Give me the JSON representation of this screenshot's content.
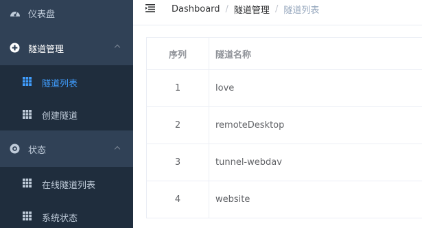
{
  "sidebar": {
    "dashboard": "仪表盘",
    "tunnel_mgmt": "隧道管理",
    "tunnel_list": "隧道列表",
    "create_tunnel": "创建隧道",
    "status": "状态",
    "online_list": "在线隧道列表",
    "system_status": "系统状态"
  },
  "breadcrumb": {
    "home": "Dashboard",
    "sep": "/",
    "section": "隧道管理",
    "current": "隧道列表"
  },
  "table": {
    "headers": {
      "index": "序列",
      "name": "隧道名称"
    },
    "rows": [
      {
        "index": "1",
        "name": "love"
      },
      {
        "index": "2",
        "name": "remoteDesktop"
      },
      {
        "index": "3",
        "name": "tunnel-webdav"
      },
      {
        "index": "4",
        "name": "website"
      }
    ]
  },
  "colors": {
    "sidebar_bg": "#304156",
    "submenu_bg": "#1f2d3d",
    "active": "#409eff",
    "menu_text": "#bfcbd9"
  },
  "icons": [
    "dashboard-icon",
    "plus-circle-icon",
    "grid-icon",
    "status-icon",
    "chevron-up-icon",
    "hamburger-icon"
  ]
}
